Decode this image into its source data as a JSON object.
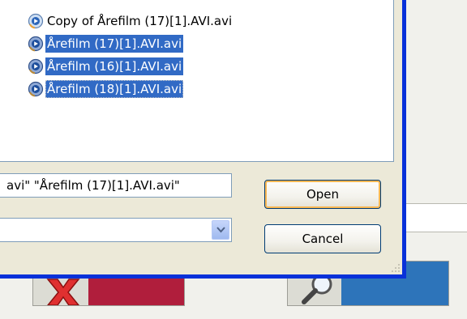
{
  "dialog": {
    "files": [
      {
        "name": "Copy of Årefilm (17)[1].AVI.avi",
        "selected": false,
        "focused": false
      },
      {
        "name": "Årefilm (17)[1].AVI.avi",
        "selected": true,
        "focused": false
      },
      {
        "name": "Årefilm (16)[1].AVI.avi",
        "selected": true,
        "focused": false
      },
      {
        "name": "Årefilm (18)[1].AVI.avi",
        "selected": true,
        "focused": true
      }
    ],
    "file_name_value": "avi\" \"Årefilm (17)[1].AVI.avi\"",
    "file_type_value": "",
    "open_label": "Open",
    "cancel_label": "Cancel"
  },
  "background": {
    "left_button_icon": "delete-icon",
    "right_button_icon": "search-icon",
    "left_button_color": "#b01e3c",
    "right_button_color": "#2d74ba"
  },
  "colors": {
    "selection": "#316ac5",
    "dialog_frame": "#0831d9",
    "dialog_face": "#ece9d8"
  }
}
